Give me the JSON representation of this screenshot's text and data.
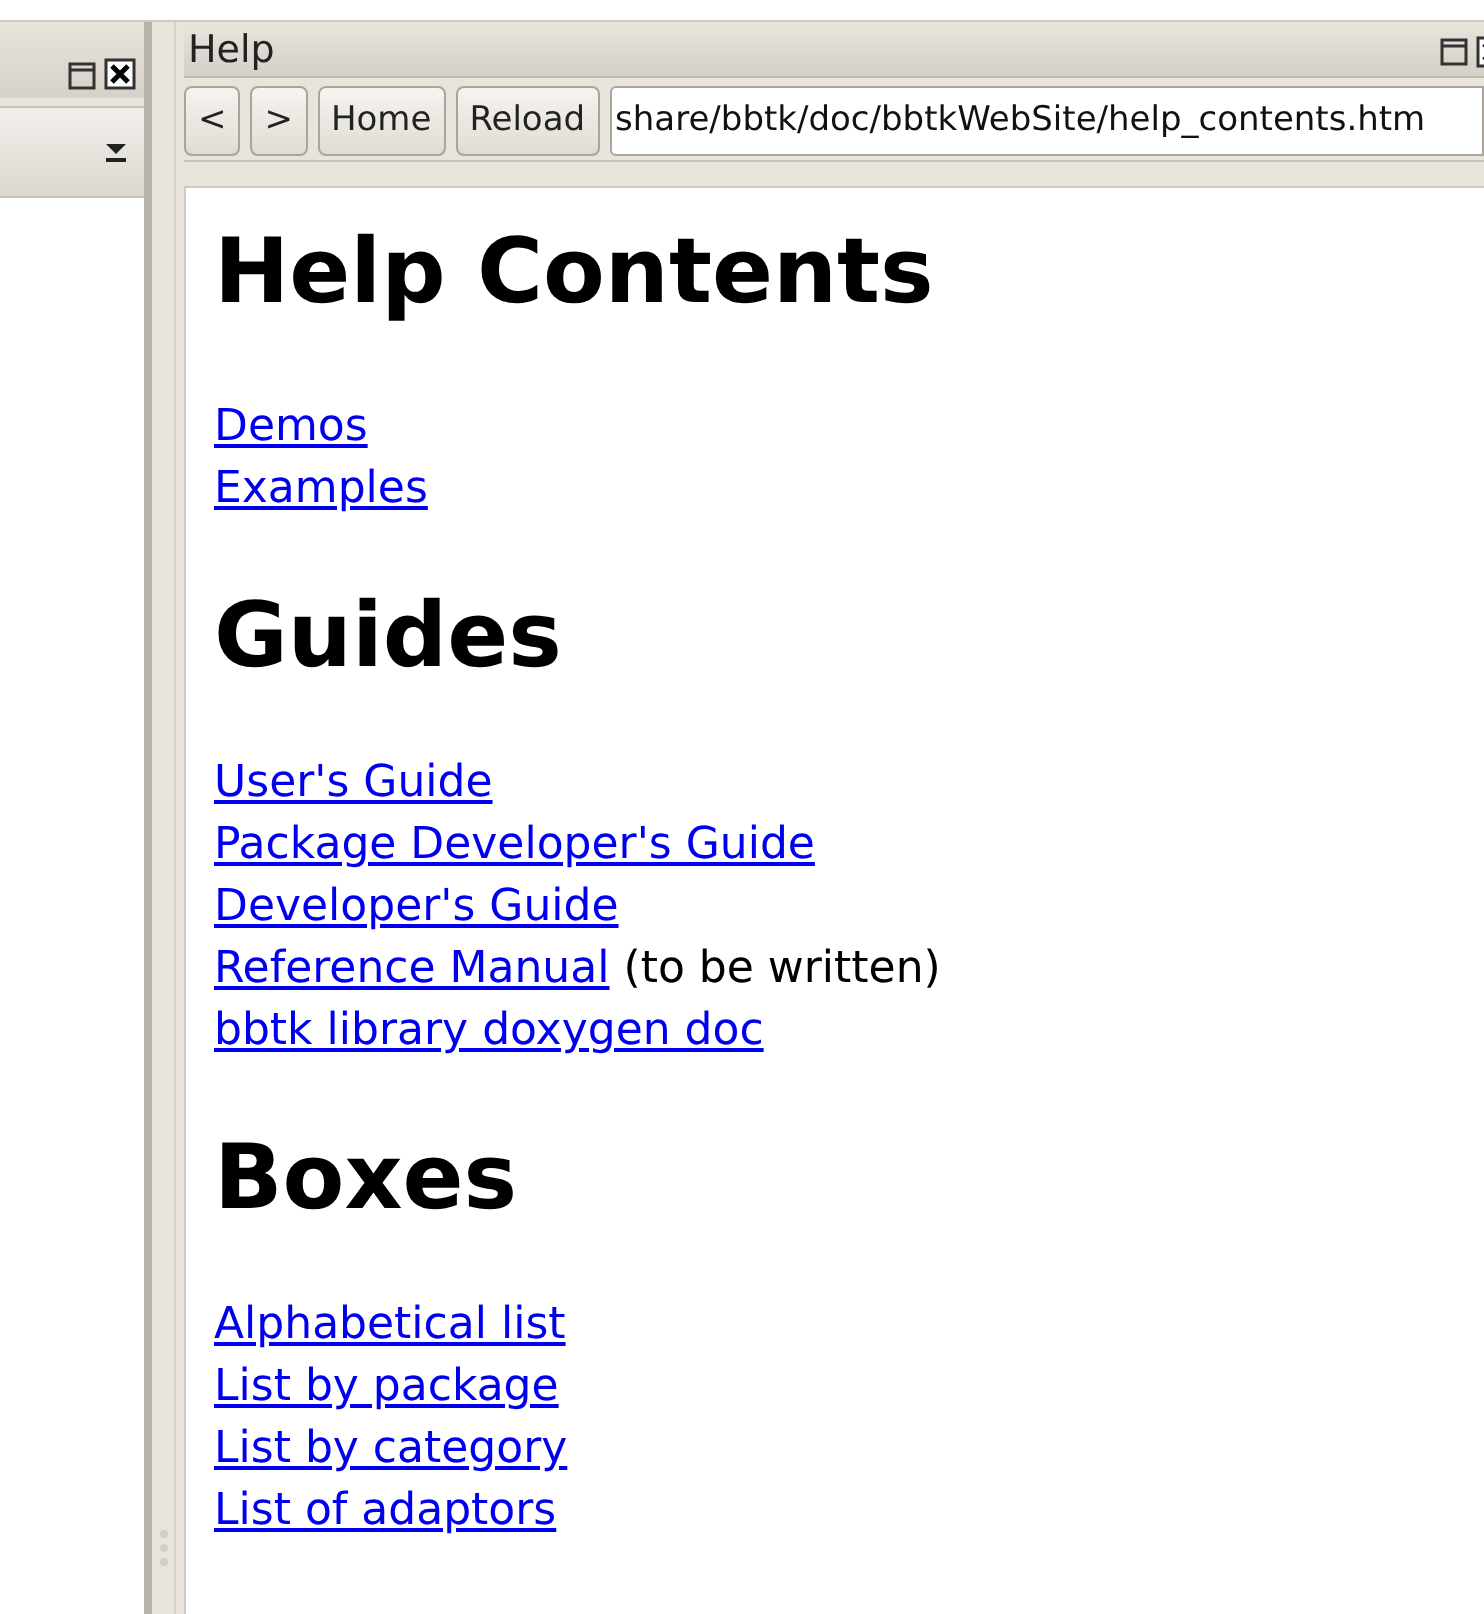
{
  "help_pane": {
    "title": "Help",
    "toolbar": {
      "buttons": [
        "<",
        ">",
        "Home",
        "Reload"
      ],
      "url": "share/bbtk/doc/bbtkWebSite/help_contents.htm"
    },
    "sections": [
      {
        "heading": "Help Contents",
        "links": [
          {
            "text": "Demos"
          },
          {
            "text": "Examples"
          }
        ]
      },
      {
        "heading": "Guides",
        "links": [
          {
            "text": "User's Guide"
          },
          {
            "text": "Package Developer's Guide"
          },
          {
            "text": "Developer's Guide"
          },
          {
            "text": "Reference Manual",
            "note": "(to be written)"
          },
          {
            "text": "bbtk library doxygen doc"
          }
        ]
      },
      {
        "heading": "Boxes",
        "links": [
          {
            "text": "Alphabetical list"
          },
          {
            "text": "List by package"
          },
          {
            "text": "List by category"
          },
          {
            "text": "List of adaptors"
          }
        ]
      }
    ]
  }
}
